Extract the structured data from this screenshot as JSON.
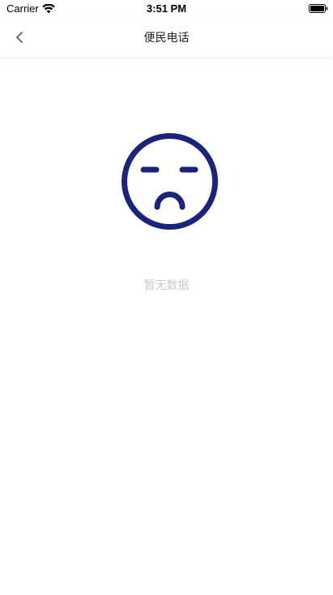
{
  "status_bar": {
    "carrier": "Carrier",
    "time": "3:51 PM",
    "wifi_icon": "wifi-icon",
    "battery_icon": "battery-icon"
  },
  "nav": {
    "title": "便民电话",
    "back_icon": "chevron-left-icon"
  },
  "empty_state": {
    "icon": "sad-face-icon",
    "icon_color": "#1a237e",
    "message": "暂无数据"
  }
}
